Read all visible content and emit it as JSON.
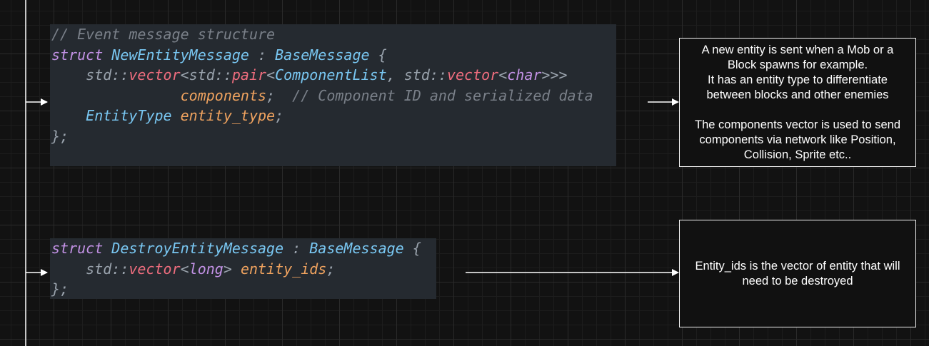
{
  "code_block_1": {
    "lines": [
      [
        {
          "t": "// Event message structure",
          "c": "cm"
        }
      ],
      [
        {
          "t": "struct",
          "c": "kw"
        },
        {
          "t": " "
        },
        {
          "t": "NewEntityMessage",
          "c": "ty"
        },
        {
          "t": " : ",
          "c": "pu"
        },
        {
          "t": "BaseMessage",
          "c": "ty"
        },
        {
          "t": " {",
          "c": "pu"
        }
      ],
      [
        {
          "t": "    std",
          "c": "pu"
        },
        {
          "t": "::",
          "c": "pu"
        },
        {
          "t": "vector",
          "c": "fn"
        },
        {
          "t": "<std::",
          "c": "pu"
        },
        {
          "t": "pair",
          "c": "fn"
        },
        {
          "t": "<",
          "c": "pu"
        },
        {
          "t": "ComponentList",
          "c": "ty"
        },
        {
          "t": ", std::",
          "c": "pu"
        },
        {
          "t": "vector",
          "c": "fn"
        },
        {
          "t": "<",
          "c": "pu"
        },
        {
          "t": "char",
          "c": "kw"
        },
        {
          "t": ">>>",
          "c": "pu"
        }
      ],
      [
        {
          "t": "               "
        },
        {
          "t": "components",
          "c": "id"
        },
        {
          "t": ";",
          "c": "pu"
        },
        {
          "t": "  // Component ID and serialized data",
          "c": "cm"
        }
      ],
      [
        {
          "t": "    "
        },
        {
          "t": "EntityType",
          "c": "ty"
        },
        {
          "t": " "
        },
        {
          "t": "entity_type",
          "c": "id"
        },
        {
          "t": ";",
          "c": "pu"
        }
      ],
      [
        {
          "t": "};",
          "c": "pu"
        }
      ]
    ]
  },
  "code_block_2": {
    "lines": [
      [
        {
          "t": "struct",
          "c": "kw"
        },
        {
          "t": " "
        },
        {
          "t": "DestroyEntityMessage",
          "c": "ty"
        },
        {
          "t": " : ",
          "c": "pu"
        },
        {
          "t": "BaseMessage",
          "c": "ty"
        },
        {
          "t": " {",
          "c": "pu"
        }
      ],
      [
        {
          "t": "    std::",
          "c": "pu"
        },
        {
          "t": "vector",
          "c": "fn"
        },
        {
          "t": "<",
          "c": "pu"
        },
        {
          "t": "long",
          "c": "kw"
        },
        {
          "t": ">",
          "c": "pu"
        },
        {
          "t": " "
        },
        {
          "t": "entity_ids",
          "c": "id"
        },
        {
          "t": ";",
          "c": "pu"
        }
      ],
      [
        {
          "t": "};",
          "c": "pu"
        }
      ]
    ]
  },
  "note_1": "A new entity is sent when a Mob or a\nBlock spawns for example.\nIt has an entity type to differentiate\nbetween blocks and other enemies\n\nThe components vector is used to send\ncomponents via network like Position,\nCollision, Sprite etc..",
  "note_2": "Entity_ids is the vector of entity that will\nneed to be destroyed"
}
